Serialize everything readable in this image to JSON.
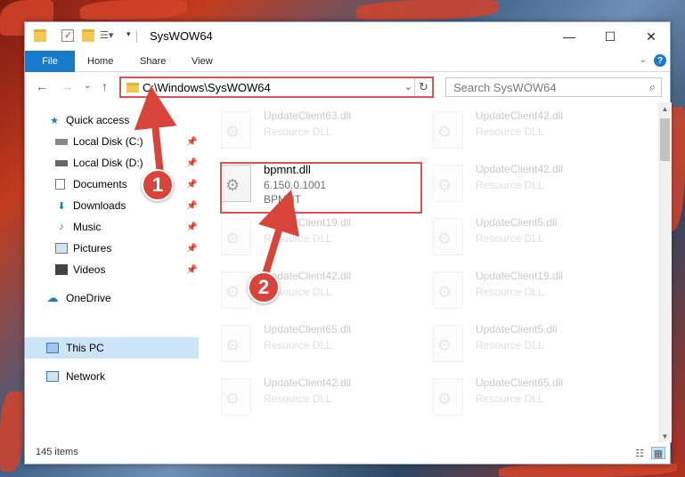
{
  "window": {
    "title": "SysWOW64",
    "minimize": "—",
    "maximize": "☐",
    "close": "✕"
  },
  "ribbon": {
    "file": "File",
    "home": "Home",
    "share": "Share",
    "view": "View"
  },
  "address": {
    "path": "C:\\Windows\\SysWOW64"
  },
  "search": {
    "placeholder": "Search SysWOW64"
  },
  "sidebar": {
    "items": [
      {
        "label": "Quick access"
      },
      {
        "label": "Local Disk (C:)"
      },
      {
        "label": "Local Disk (D:)"
      },
      {
        "label": "Documents"
      },
      {
        "label": "Downloads"
      },
      {
        "label": "Music"
      },
      {
        "label": "Pictures"
      },
      {
        "label": "Videos"
      },
      {
        "label": "OneDrive"
      },
      {
        "label": "This PC"
      },
      {
        "label": "Network"
      }
    ]
  },
  "files": [
    {
      "name": "UpdateClient63.dll",
      "line2": "Resource DLL",
      "line3": ""
    },
    {
      "name": "UpdateClient42.dll",
      "line2": "Resource DLL",
      "line3": ""
    },
    {
      "name": "bpmnt.dll",
      "line2": "6.150.0.1001",
      "line3": "BPMNT"
    },
    {
      "name": "UpdateClient42.dll",
      "line2": "Resource DLL",
      "line3": ""
    },
    {
      "name": "UpdateClient19.dll",
      "line2": "Resource DLL",
      "line3": ""
    },
    {
      "name": "UpdateClient5.dll",
      "line2": "Resource DLL",
      "line3": ""
    },
    {
      "name": "UpdateClient42.dll",
      "line2": "Resource DLL",
      "line3": ""
    },
    {
      "name": "UpdateClient19.dll",
      "line2": "Resource DLL",
      "line3": ""
    },
    {
      "name": "UpdateClient65.dll",
      "line2": "Resource DLL",
      "line3": ""
    },
    {
      "name": "UpdateClient5.dll",
      "line2": "Resource DLL",
      "line3": ""
    },
    {
      "name": "UpdateClient42.dll",
      "line2": "Resource DLL",
      "line3": ""
    },
    {
      "name": "UpdateClient65.dll",
      "line2": "Resource DLL",
      "line3": ""
    }
  ],
  "status": {
    "count": "145 items"
  },
  "callouts": {
    "one": "1",
    "two": "2"
  },
  "colors": {
    "accent": "#1979ca",
    "annotation": "#d9534f",
    "selected": "#cce4f7"
  }
}
